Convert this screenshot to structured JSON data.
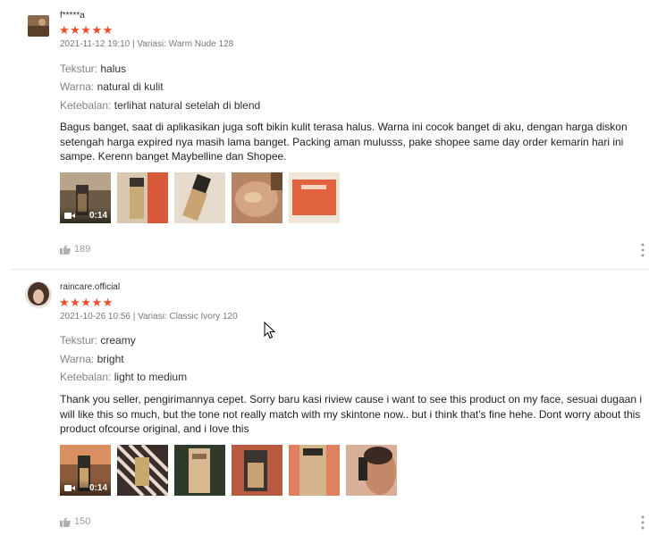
{
  "reviews": [
    {
      "username": "f*****a",
      "stars": "★★★★★",
      "meta": "2021-11-12 19:10 | Variasi: Warm Nude 128",
      "attributes": [
        {
          "key": "Tekstur:",
          "value": "halus"
        },
        {
          "key": "Warna:",
          "value": "natural di kulit"
        },
        {
          "key": "Ketebalan:",
          "value": "terlihat natural setelah di blend"
        }
      ],
      "comment": "Bagus banget, saat di aplikasikan juga soft bikin kulit terasa halus. Warna ini cocok banget di aku, dengan harga diskon setengah harga expired nya masih lama banget. Packing aman mulusss, pake shopee same day order kemarin hari ini sampe. Kerenn banget Maybelline dan Shopee.",
      "video_duration": "0:14",
      "likes": "189"
    },
    {
      "username": "raincare.official",
      "stars": "★★★★★",
      "meta": "2021-10-26 10:56 | Variasi: Classic Ivory 120",
      "attributes": [
        {
          "key": "Tekstur:",
          "value": "creamy"
        },
        {
          "key": "Warna:",
          "value": "bright"
        },
        {
          "key": "Ketebalan:",
          "value": "light to medium"
        }
      ],
      "comment": "Thank you seller, pengirimannya cepet. Sorry baru kasi riview cause i want to see this product on my face, sesuai dugaan i will like this so much, but the tone not really match with my skintone now.. but i think that's fine hehe. Dont worry about this product ofcourse original, and i love this",
      "video_duration": "0:14",
      "likes": "150"
    }
  ],
  "colors": {
    "star": "#ee4d2d",
    "muted": "#8a8a8a"
  },
  "icons": [
    "star-icon",
    "video-camera-icon",
    "thumbs-up-icon",
    "more-vertical-icon",
    "mouse-cursor-icon"
  ]
}
